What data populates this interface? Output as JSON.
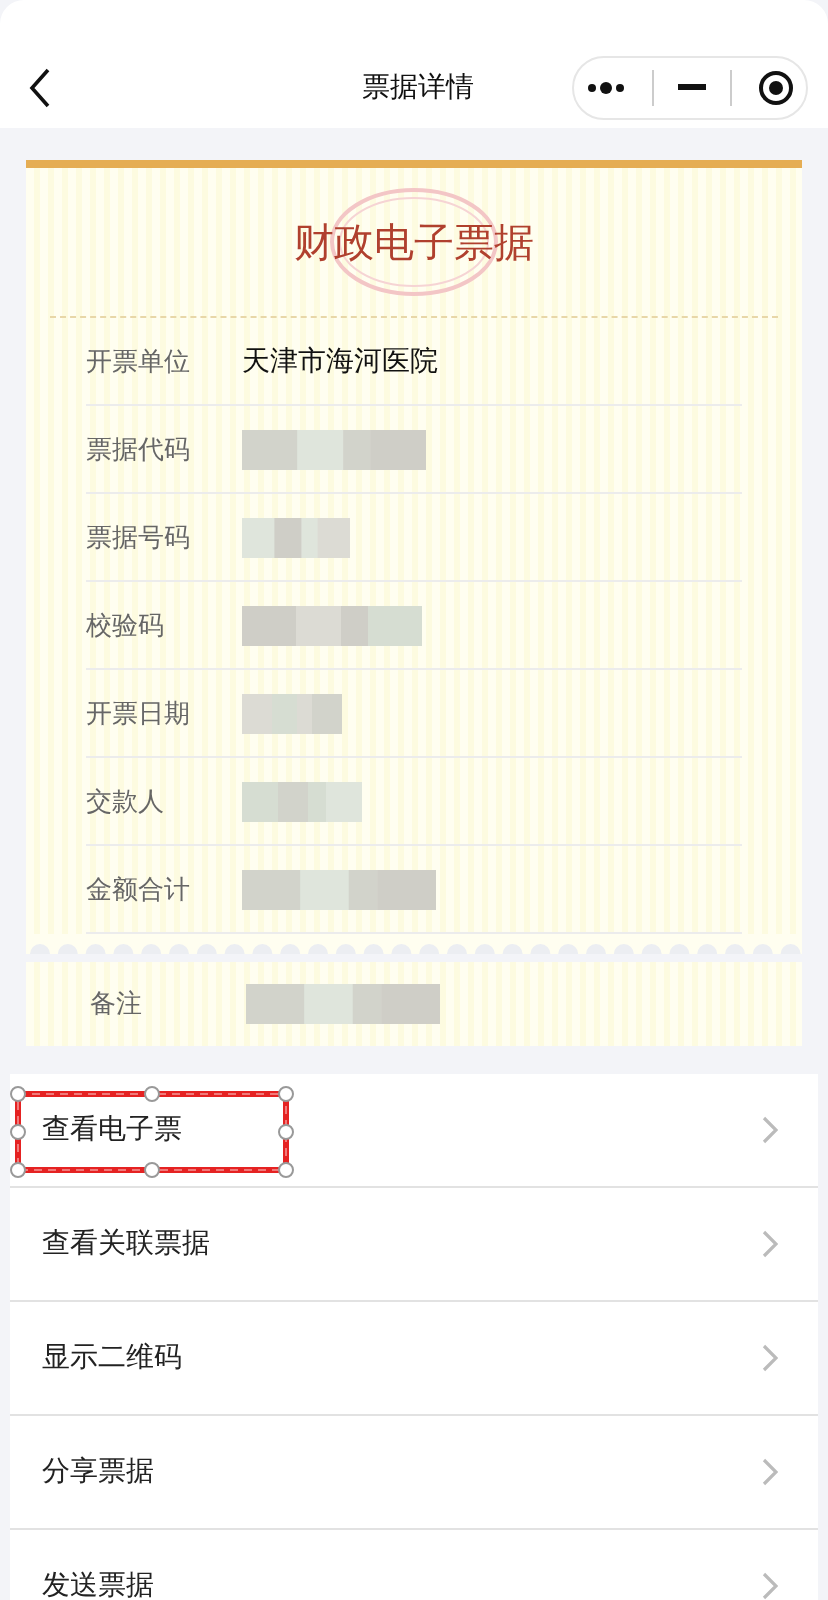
{
  "nav": {
    "title": "票据详情"
  },
  "receipt": {
    "title": "财政电子票据",
    "fields": [
      {
        "label": "开票单位",
        "kind": "text",
        "value": "天津市海河医院"
      },
      {
        "label": "票据代码",
        "kind": "redacted"
      },
      {
        "label": "票据号码",
        "kind": "redacted"
      },
      {
        "label": "校验码",
        "kind": "redacted"
      },
      {
        "label": "开票日期",
        "kind": "redacted"
      },
      {
        "label": "交款人",
        "kind": "redacted"
      },
      {
        "label": "金额合计",
        "kind": "redacted"
      }
    ],
    "remark": {
      "label": "备注",
      "kind": "redacted"
    }
  },
  "menu": [
    {
      "label": "查看电子票",
      "highlighted": true
    },
    {
      "label": "查看关联票据",
      "highlighted": false
    },
    {
      "label": "显示二维码",
      "highlighted": false
    },
    {
      "label": "分享票据",
      "highlighted": false
    },
    {
      "label": "发送票据",
      "highlighted": false
    }
  ]
}
